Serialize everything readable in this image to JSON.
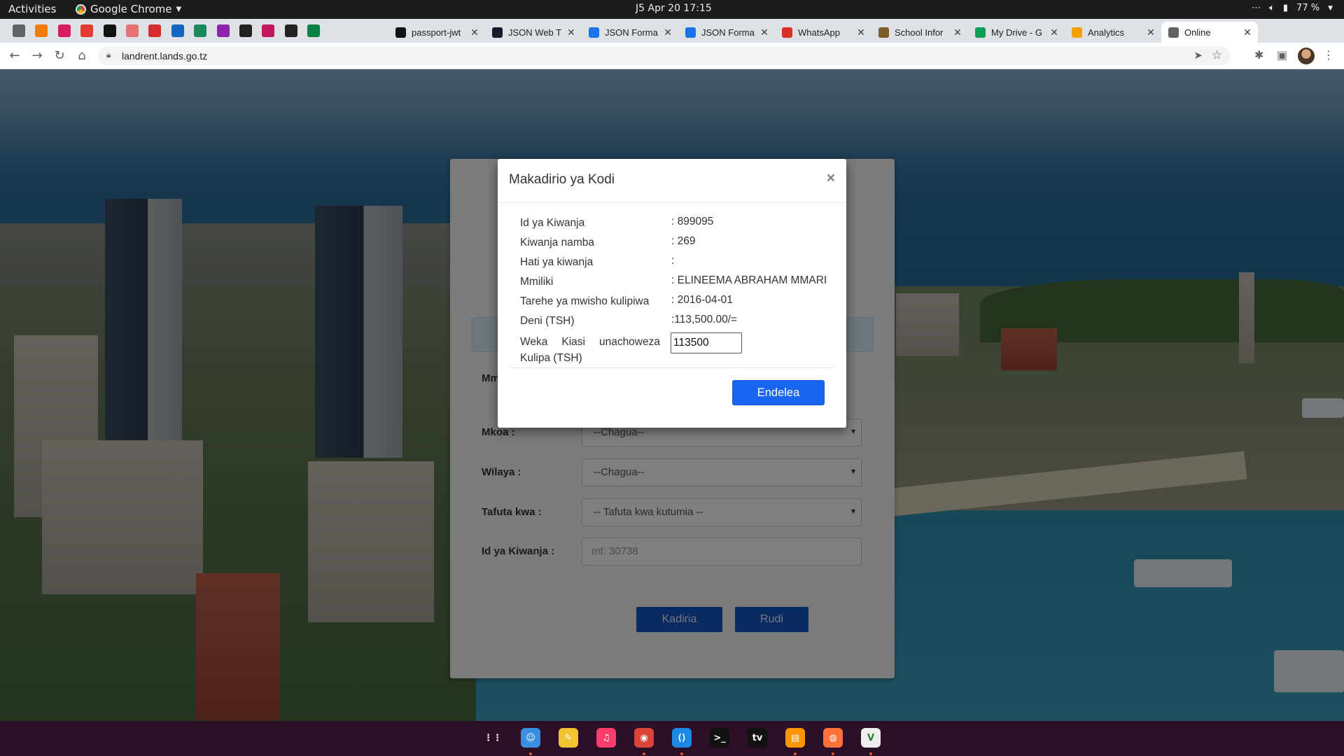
{
  "topbar": {
    "activities": "Activities",
    "app_name": "Google Chrome",
    "clock": "J5 Apr 20  17:15",
    "battery": "77 %"
  },
  "tabs": [
    {
      "title": "passport-jwt",
      "icon": "passport-icon",
      "color": "#111111"
    },
    {
      "title": "JSON Web T",
      "icon": "jwt-icon",
      "color": "#1a1a2e"
    },
    {
      "title": "JSON Forma",
      "icon": "checkbox-icon",
      "color": "#1a73e8"
    },
    {
      "title": "JSON Forma",
      "icon": "checkbox-icon",
      "color": "#1a73e8"
    },
    {
      "title": "WhatsApp",
      "icon": "whatsapp-icon",
      "color": "#d93025"
    },
    {
      "title": "School Infor",
      "icon": "school-icon",
      "color": "#7b5e2a"
    },
    {
      "title": "My Drive - G",
      "icon": "drive-icon",
      "color": "#0f9d58"
    },
    {
      "title": "Analytics",
      "icon": "analytics-icon",
      "color": "#f4a100"
    },
    {
      "title": "Online",
      "icon": "globe-icon",
      "color": "#5f6368"
    }
  ],
  "pinned_tab_colors": [
    "#5f6368",
    "#f57c00",
    "#d81b60",
    "#e53935",
    "#111111",
    "#e57373",
    "#d32f2f",
    "#1565c0",
    "#1b8a5a",
    "#8e24aa",
    "#222222",
    "#c2185b",
    "#222222",
    "#0b8043"
  ],
  "address_bar": {
    "url": "landrent.lands.go.tz"
  },
  "form": {
    "mm_label": "Mm",
    "mkoa_label": "Mkoa :",
    "mkoa_value": "--Chagua--",
    "wilaya_label": "Wilaya :",
    "wilaya_value": "--Chagua--",
    "tafuta_label": "Tafuta kwa :",
    "tafuta_value": "-- Tafuta kwa kutumia --",
    "id_label": "Id ya Kiwanja :",
    "id_placeholder": "mf: 30738",
    "kadiria_button": "Kadiria",
    "rudi_button": "Rudi"
  },
  "modal": {
    "title": "Makadirio ya Kodi",
    "close": "×",
    "rows": [
      {
        "label": "Id ya Kiwanja",
        "value": ": 899095"
      },
      {
        "label": "Kiwanja namba",
        "value": ": 269"
      },
      {
        "label": "Hati ya kiwanja",
        "value": ":"
      },
      {
        "label": "Mmiliki",
        "value": ": ELINEEMA ABRAHAM MMARI"
      },
      {
        "label": "Tarehe ya mwisho kulipiwa",
        "value": ": 2016-04-01"
      },
      {
        "label": "Deni (TSH)",
        "value": ":113,500.00/="
      }
    ],
    "pay_label": "Weka Kiasi unachoweza Kulipa (TSH)",
    "pay_value": "113500",
    "continue_button": "Endelea"
  },
  "dock": [
    {
      "name": "app-grid-icon",
      "glyph": "⋮⋮",
      "color": "#2c0f26",
      "running": false
    },
    {
      "name": "finder-icon",
      "glyph": "☺",
      "color": "#3b8fe0",
      "running": true
    },
    {
      "name": "notes-icon",
      "glyph": "✎",
      "color": "#f1c232",
      "running": false
    },
    {
      "name": "music-icon",
      "glyph": "♫",
      "color": "#fc3c6a",
      "running": false
    },
    {
      "name": "chrome-icon",
      "glyph": "◉",
      "color": "#db4437",
      "running": true
    },
    {
      "name": "vscode-icon",
      "glyph": "⟨⟩",
      "color": "#1e88e5",
      "running": true
    },
    {
      "name": "terminal-icon",
      "glyph": ">_",
      "color": "#111111",
      "running": false
    },
    {
      "name": "appletv-icon",
      "glyph": "tv",
      "color": "#111111",
      "running": false
    },
    {
      "name": "books-icon",
      "glyph": "▤",
      "color": "#ff9500",
      "running": true
    },
    {
      "name": "firefox-icon",
      "glyph": "◍",
      "color": "#ff7139",
      "running": true
    },
    {
      "name": "vim-icon",
      "glyph": "V",
      "color": "#eeeeee",
      "running": true
    }
  ]
}
